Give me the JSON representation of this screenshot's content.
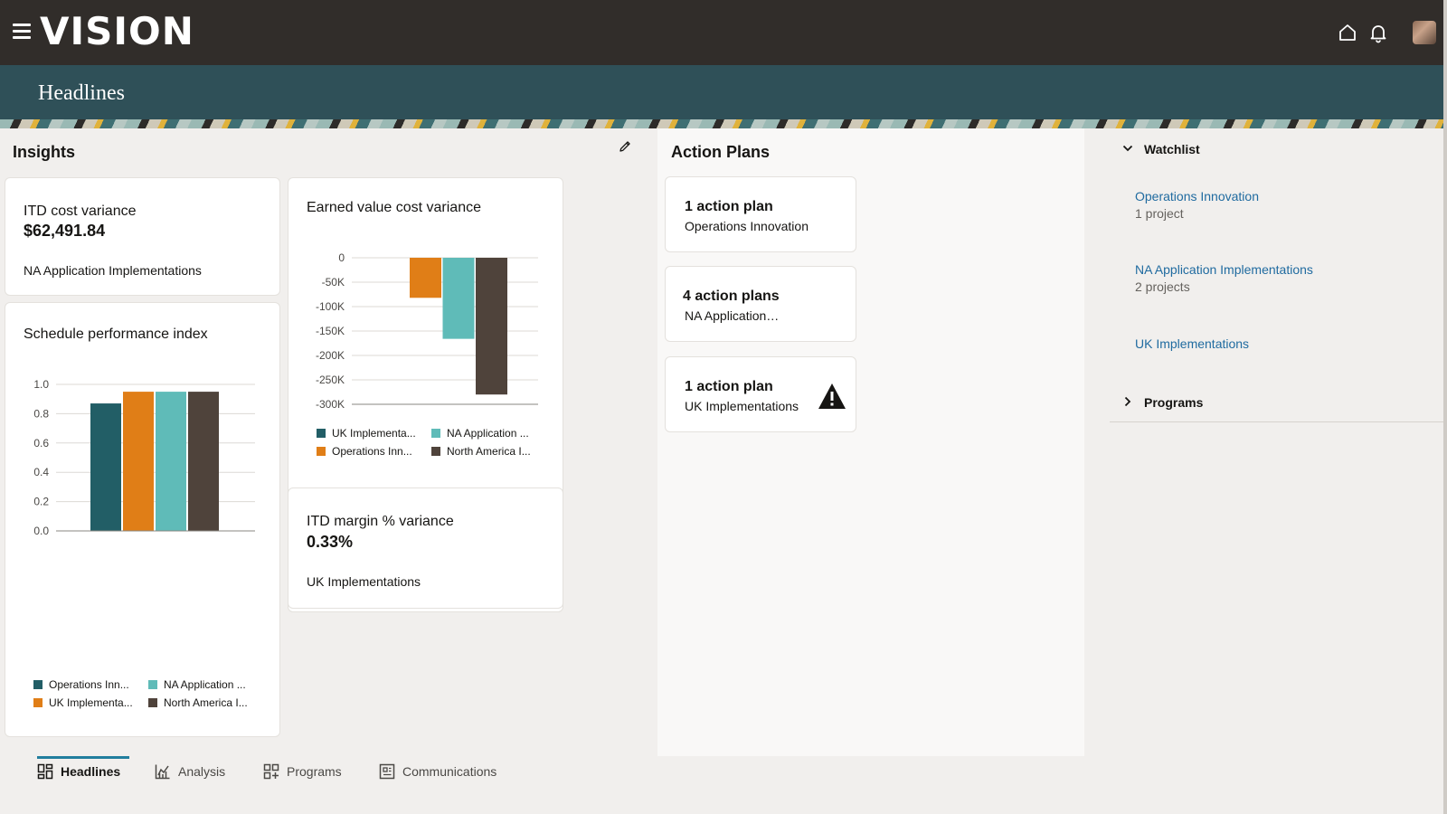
{
  "app": {
    "logo": "VISION"
  },
  "banner": {
    "title": "Headlines"
  },
  "insights": {
    "title": "Insights",
    "itd_cost": {
      "title": "ITD cost variance",
      "value": "$62,491.84",
      "sub": "NA Application Implementations"
    },
    "spi": {
      "title": "Schedule performance index",
      "legend": [
        "Operations Inn...",
        "NA Application ...",
        "UK Implementa...",
        "North America I..."
      ]
    },
    "evcv": {
      "title": "Earned value cost variance",
      "legend": [
        "UK Implementa...",
        "NA Application ...",
        "Operations Inn...",
        "North America I..."
      ]
    },
    "margin": {
      "title": "ITD margin % variance",
      "value": "0.33%",
      "sub": "UK Implementations"
    }
  },
  "chart_data": [
    {
      "type": "bar",
      "title": "Schedule performance index",
      "categories": [
        "Operations Inn...",
        "UK Implementa...",
        "NA Application ...",
        "North America I..."
      ],
      "values": [
        0.87,
        0.95,
        0.95,
        0.95
      ],
      "colors": [
        "#225e66",
        "#e07e17",
        "#5fbbb8",
        "#4f433b"
      ],
      "ylim": [
        0,
        1.0
      ],
      "yticks": [
        "1.0",
        "0.8",
        "0.6",
        "0.4",
        "0.2",
        "0.0"
      ],
      "grid": true,
      "legend": "bottom"
    },
    {
      "type": "bar",
      "title": "Earned value cost variance",
      "categories": [
        "Operations Inn...",
        "NA Application ...",
        "North America I..."
      ],
      "values": [
        -82000,
        -166000,
        -280000
      ],
      "colors": [
        "#e07e17",
        "#5fbbb8",
        "#4f433b"
      ],
      "ylim": [
        -300000,
        0
      ],
      "yticks": [
        "0",
        "-50K",
        "-100K",
        "-150K",
        "-200K",
        "-250K",
        "-300K"
      ],
      "grid": true,
      "legend": "bottom"
    }
  ],
  "action_plans": {
    "title": "Action Plans",
    "items": [
      {
        "count": "1 action plan",
        "name": "Operations Innovation"
      },
      {
        "count": "4 action plans",
        "name": "NA Application…"
      },
      {
        "count": "1 action plan",
        "name": "UK Implementations"
      }
    ]
  },
  "watchlist": {
    "title": "Watchlist",
    "items": [
      {
        "name": "Operations Innovation",
        "sub": "1 project"
      },
      {
        "name": "NA Application Implementations",
        "sub": "2 projects"
      },
      {
        "name": "UK Implementations",
        "sub": ""
      }
    ],
    "programs": "Programs"
  },
  "tabs": [
    "Headlines",
    "Analysis",
    "Programs",
    "Communications"
  ],
  "colors": {
    "teal": "#225e66",
    "orange": "#e07e17",
    "aqua": "#5fbbb8",
    "brown": "#4f433b",
    "link": "#206ba0"
  }
}
